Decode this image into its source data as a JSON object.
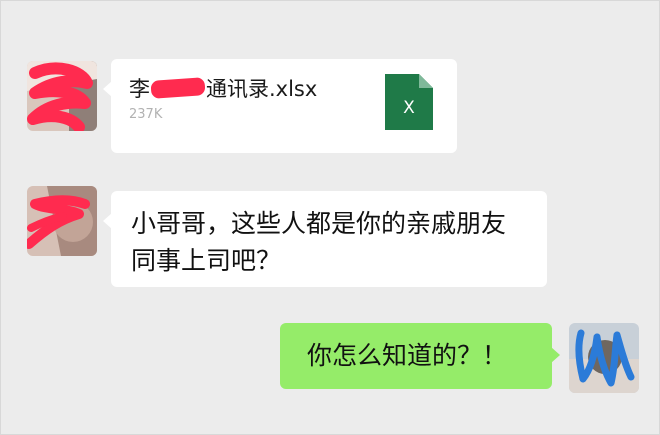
{
  "messages": [
    {
      "sender": "contact",
      "type": "file",
      "file": {
        "name_prefix": "李",
        "name_suffix": "通讯录.xlsx",
        "size": "237K",
        "icon": "excel-file-icon",
        "icon_color": "#1f7a48"
      }
    },
    {
      "sender": "contact",
      "type": "text",
      "text": "小哥哥，这些人都是你的亲戚朋友同事上司吧？"
    },
    {
      "sender": "self",
      "type": "text",
      "text": "你怎么知道的？！"
    }
  ],
  "colors": {
    "background": "#ececec",
    "incoming_bubble": "#ffffff",
    "outgoing_bubble": "#95ec69",
    "redaction_red": "#ff2b4f",
    "redaction_blue": "#2b7bd8"
  }
}
